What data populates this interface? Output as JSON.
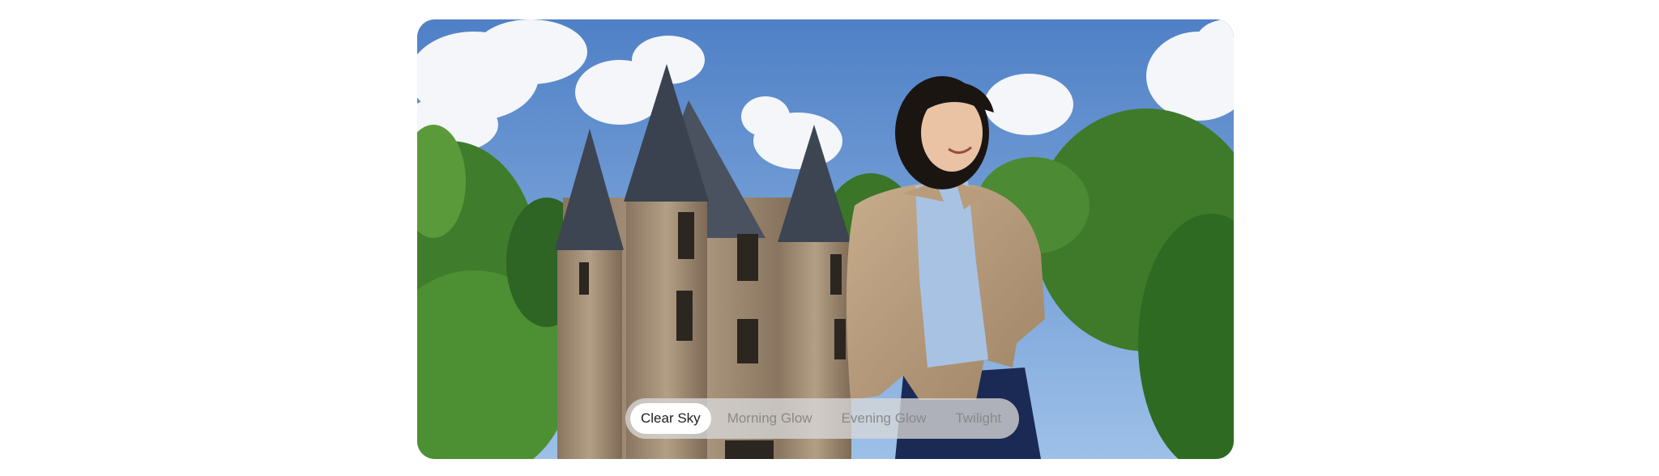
{
  "viewer": {
    "image_description_label": "castle-portrait-photo"
  },
  "filters": {
    "selected": "Clear Sky",
    "options": [
      {
        "label": "Clear Sky",
        "active": true
      },
      {
        "label": "Morning Glow",
        "active": false
      },
      {
        "label": "Evening Glow",
        "active": false
      },
      {
        "label": "Twilight",
        "active": false
      }
    ]
  },
  "colors": {
    "sky": "#5f8fd0",
    "chip_active_bg": "#ffffff",
    "chip_inactive_text": "#8a8a8a",
    "bar_bg": "#d7d7d7"
  }
}
